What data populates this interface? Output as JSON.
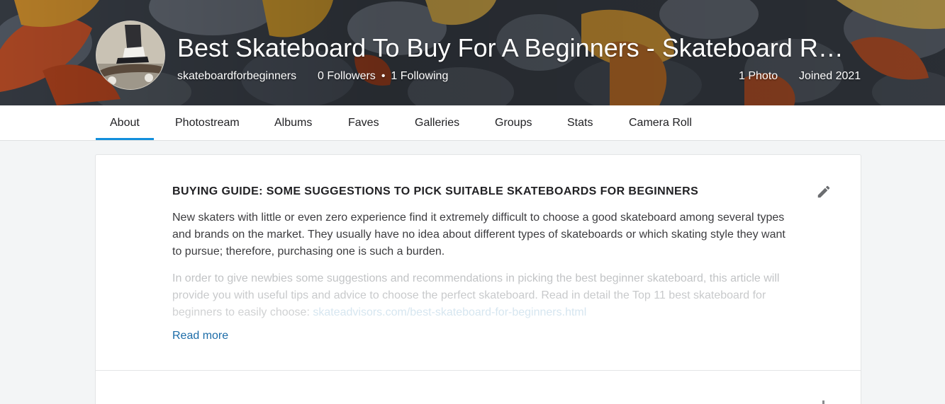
{
  "profile": {
    "title": "Best Skateboard To Buy For A Beginners - Skateboard R…",
    "username": "skateboardforbeginners",
    "followers": "0 Followers",
    "separator": "•",
    "following": "1 Following",
    "photos": "1 Photo",
    "joined": "Joined 2021",
    "avatar_icon": "skateboard-photo-avatar"
  },
  "subnav": {
    "tabs": [
      {
        "label": "About",
        "active": true
      },
      {
        "label": "Photostream",
        "active": false
      },
      {
        "label": "Albums",
        "active": false
      },
      {
        "label": "Faves",
        "active": false
      },
      {
        "label": "Galleries",
        "active": false
      },
      {
        "label": "Groups",
        "active": false
      },
      {
        "label": "Stats",
        "active": false
      },
      {
        "label": "Camera Roll",
        "active": false
      }
    ]
  },
  "about": {
    "heading": "BUYING GUIDE: SOME SUGGESTIONS TO PICK SUITABLE SKATEBOARDS FOR BEGINNERS",
    "paragraph_1": "New skaters with little or even zero experience find it extremely difficult to choose a good skateboard among several types and brands on the market. They usually have no idea about different types of skateboards or which skating style they want to pursue; therefore, purchasing one is such a burden.",
    "paragraph_2": "In order to give newbies some suggestions and recommendations in picking the best beginner skateboard, this article will provide you with useful tips and advice to choose the perfect skateboard. Read in detail the Top 11 best skateboard for beginners to easily choose: ",
    "link_text": "skateadvisors.com/best-skateboard-for-beginners.html",
    "read_more": "Read more",
    "edit_icon": "pencil-icon"
  },
  "colors": {
    "accent": "#128fdc",
    "link": "#1c6ca8",
    "page_bg": "#f3f5f6"
  }
}
